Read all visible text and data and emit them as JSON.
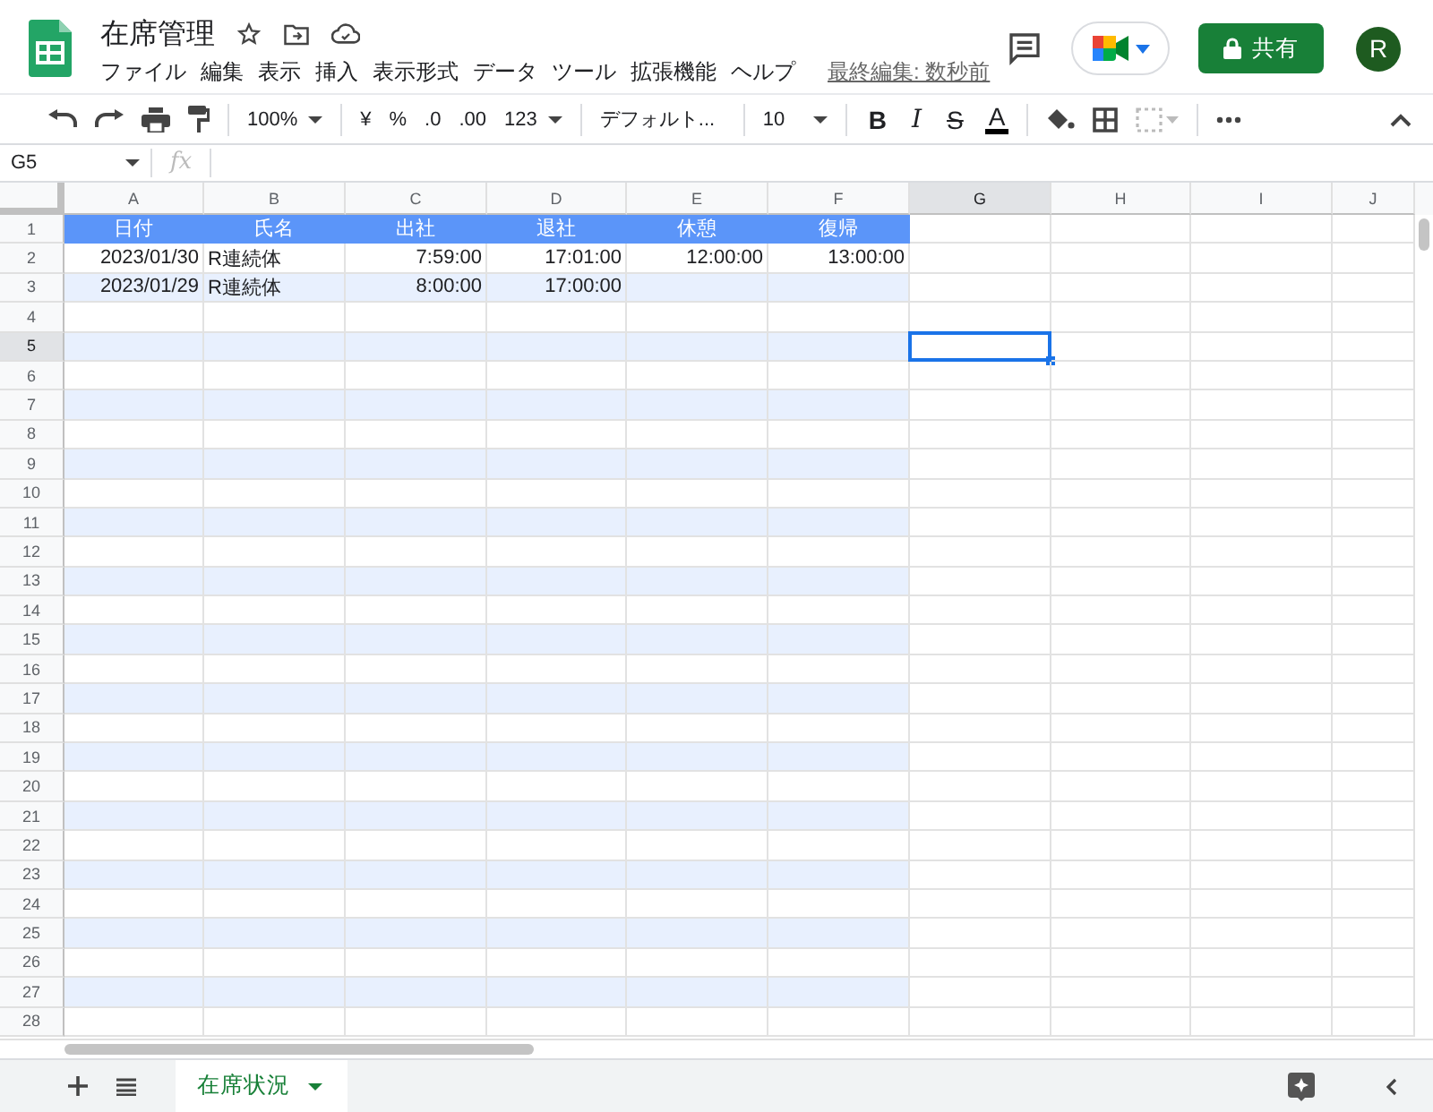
{
  "doc": {
    "title": "在席管理",
    "menu": [
      "ファイル",
      "編集",
      "表示",
      "挿入",
      "表示形式",
      "データ",
      "ツール",
      "拡張機能",
      "ヘルプ"
    ],
    "last_edit": "最終編集: 数秒前",
    "share": "共有",
    "avatar": "R"
  },
  "toolbar": {
    "zoom": "100%",
    "currency": "¥",
    "percent": "%",
    "dec_less": ".0",
    "dec_more": ".00",
    "format": "123",
    "font": "デフォルト...",
    "size": "10",
    "styles": [
      "B",
      "I",
      "S",
      "A"
    ]
  },
  "formula_bar": {
    "name_box": "G5",
    "fx": "fx"
  },
  "sheet": {
    "columns": [
      {
        "label": "A",
        "selected": false
      },
      {
        "label": "B",
        "selected": false
      },
      {
        "label": "C",
        "selected": false
      },
      {
        "label": "D",
        "selected": false
      },
      {
        "label": "E",
        "selected": false
      },
      {
        "label": "F",
        "selected": false
      },
      {
        "label": "G",
        "selected": true
      },
      {
        "label": "H",
        "selected": false
      },
      {
        "label": "I",
        "selected": false
      },
      {
        "label": "J",
        "selected": false
      }
    ],
    "rows": [
      {
        "number": "1",
        "kind": "header",
        "selected": false,
        "cells": [
          {
            "text": "日付"
          },
          {
            "text": "氏名"
          },
          {
            "text": "出社"
          },
          {
            "text": "退社"
          },
          {
            "text": "休憩"
          },
          {
            "text": "復帰"
          }
        ]
      },
      {
        "number": "2",
        "kind": "plain",
        "selected": false,
        "cells": [
          {
            "text": "2023/01/30",
            "kind": "number"
          },
          {
            "text": "R連続体",
            "kind": "text"
          },
          {
            "text": "7:59:00",
            "kind": "number"
          },
          {
            "text": "17:01:00",
            "kind": "number"
          },
          {
            "text": "12:00:00",
            "kind": "number"
          },
          {
            "text": "13:00:00",
            "kind": "number"
          }
        ]
      },
      {
        "number": "3",
        "kind": "band",
        "selected": false,
        "cells": [
          {
            "text": "2023/01/29",
            "kind": "number"
          },
          {
            "text": "R連続体",
            "kind": "text"
          },
          {
            "text": "8:00:00",
            "kind": "number"
          },
          {
            "text": "17:00:00",
            "kind": "number"
          }
        ]
      },
      {
        "number": "4",
        "kind": "plain",
        "selected": false
      },
      {
        "number": "5",
        "kind": "band",
        "selected": true
      },
      {
        "number": "6",
        "kind": "plain",
        "selected": false
      },
      {
        "number": "7",
        "kind": "band",
        "selected": false
      },
      {
        "number": "8",
        "kind": "plain",
        "selected": false
      },
      {
        "number": "9",
        "kind": "band",
        "selected": false
      },
      {
        "number": "10",
        "kind": "plain",
        "selected": false
      },
      {
        "number": "11",
        "kind": "band",
        "selected": false
      },
      {
        "number": "12",
        "kind": "plain",
        "selected": false
      },
      {
        "number": "13",
        "kind": "band",
        "selected": false
      },
      {
        "number": "14",
        "kind": "plain",
        "selected": false
      },
      {
        "number": "15",
        "kind": "band",
        "selected": false
      },
      {
        "number": "16",
        "kind": "plain",
        "selected": false
      },
      {
        "number": "17",
        "kind": "band",
        "selected": false
      },
      {
        "number": "18",
        "kind": "plain",
        "selected": false
      },
      {
        "number": "19",
        "kind": "band",
        "selected": false
      },
      {
        "number": "20",
        "kind": "plain",
        "selected": false
      },
      {
        "number": "21",
        "kind": "band",
        "selected": false
      },
      {
        "number": "22",
        "kind": "plain",
        "selected": false
      },
      {
        "number": "23",
        "kind": "band",
        "selected": false
      },
      {
        "number": "24",
        "kind": "plain",
        "selected": false
      },
      {
        "number": "25",
        "kind": "band",
        "selected": false
      },
      {
        "number": "26",
        "kind": "plain",
        "selected": false
      },
      {
        "number": "27",
        "kind": "band",
        "selected": false
      },
      {
        "number": "28",
        "kind": "plain",
        "selected": false
      }
    ]
  },
  "sheet_tabs": [
    {
      "label": "在席状況",
      "selected": true
    }
  ]
}
